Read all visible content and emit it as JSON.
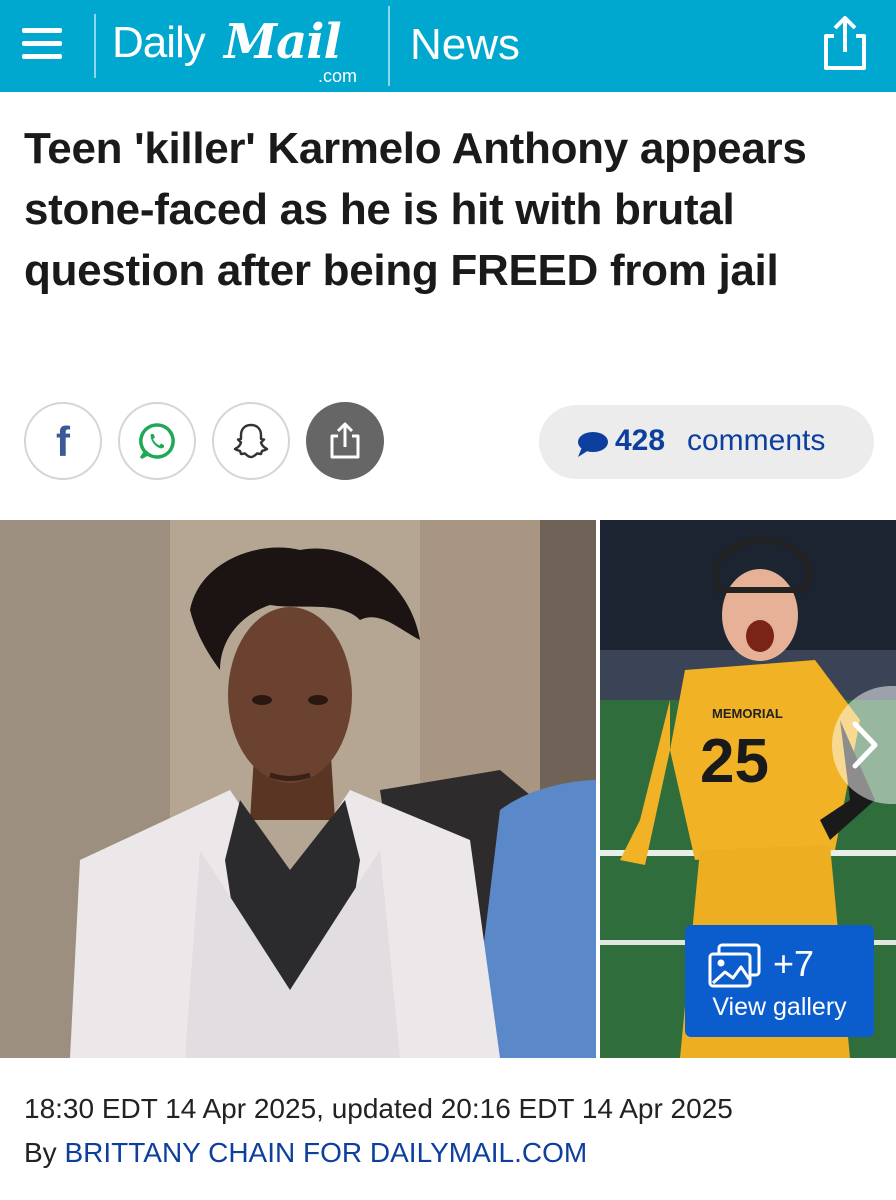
{
  "header": {
    "logo_daily": "Daily",
    "logo_mail": "Mail",
    "logo_com": ".com",
    "section": "News",
    "bg_color": "#00a7cf",
    "menu_icon": "hamburger-menu-icon",
    "share_icon": "share-icon"
  },
  "article": {
    "headline": "Teen 'killer' Karmelo Anthony appears stone-faced as he is hit with brutal question after being FREED from jail",
    "dateline": "18:30 EDT 14 Apr 2025, updated 20:16 EDT 14 Apr 2025",
    "byline_prefix": "By",
    "author": "BRITTANY CHAIN FOR DAILYMAIL.COM"
  },
  "social": {
    "facebook_label": "f",
    "facebook_icon": "facebook-icon",
    "whatsapp_icon": "whatsapp-icon",
    "snapchat_icon": "snapchat-icon",
    "share_icon": "share-icon",
    "facebook_color": "#3b5998",
    "whatsapp_color": "#1fa855"
  },
  "comments": {
    "count": "428",
    "label": "comments",
    "icon": "comment-bubble-icon",
    "color": "#0c3f9e"
  },
  "gallery": {
    "count": "+7",
    "label": "View gallery",
    "icon": "image-gallery-icon",
    "next_icon": "chevron-right-icon",
    "button_color": "#0b5ccc",
    "jersey_text": "MEMORIAL",
    "jersey_number": "25"
  }
}
